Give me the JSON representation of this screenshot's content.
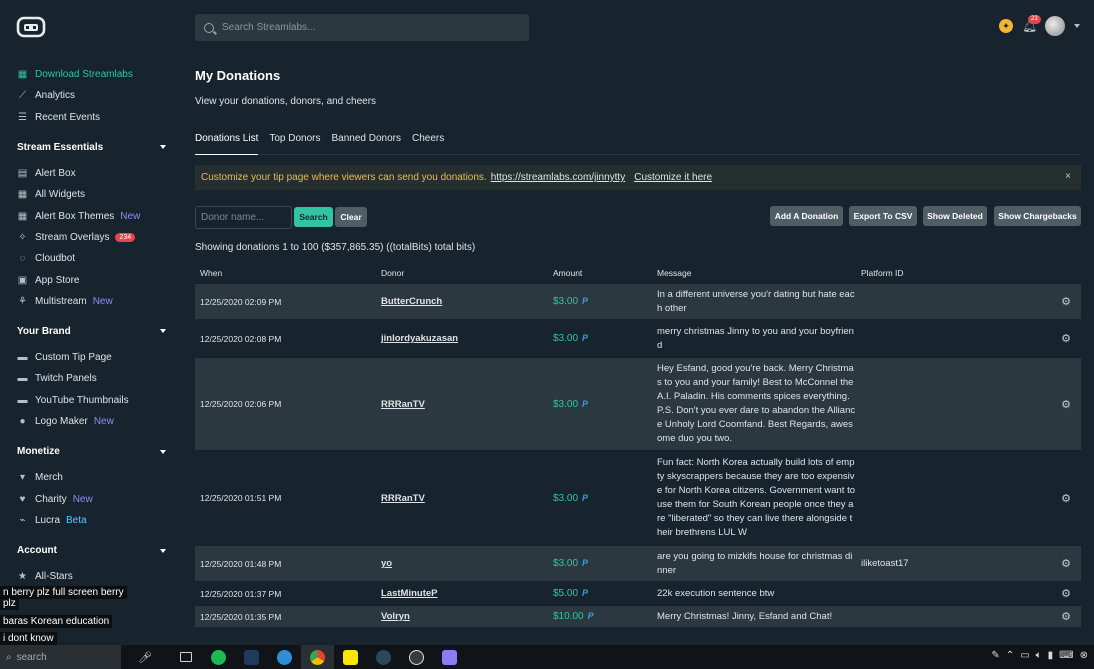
{
  "search": {
    "placeholder": "Search Streamlabs..."
  },
  "header": {
    "notification_count": "23"
  },
  "sidebar": {
    "top_items": [
      {
        "label": "Download Streamlabs",
        "icon": "windows-icon"
      },
      {
        "label": "Analytics",
        "icon": "analytics-icon"
      },
      {
        "label": "Recent Events",
        "icon": "list-icon"
      }
    ],
    "sections": [
      {
        "title": "Stream Essentials",
        "items": [
          {
            "label": "Alert Box",
            "tag": ""
          },
          {
            "label": "All Widgets",
            "tag": ""
          },
          {
            "label": "Alert Box Themes",
            "tag": "New"
          },
          {
            "label": "Stream Overlays",
            "tag": "",
            "badge": "234"
          },
          {
            "label": "Cloudbot",
            "tag": ""
          },
          {
            "label": "App Store",
            "tag": ""
          },
          {
            "label": "Multistream",
            "tag": "New"
          }
        ]
      },
      {
        "title": "Your Brand",
        "items": [
          {
            "label": "Custom Tip Page",
            "tag": ""
          },
          {
            "label": "Twitch Panels",
            "tag": ""
          },
          {
            "label": "YouTube Thumbnails",
            "tag": ""
          },
          {
            "label": "Logo Maker",
            "tag": "New"
          }
        ]
      },
      {
        "title": "Monetize",
        "items": [
          {
            "label": "Merch",
            "tag": ""
          },
          {
            "label": "Charity",
            "tag": "New"
          },
          {
            "label": "Lucra",
            "tag": "Beta"
          }
        ]
      },
      {
        "title": "Account",
        "items": [
          {
            "label": "All-Stars",
            "tag": ""
          }
        ]
      }
    ]
  },
  "overlay_chat": [
    "n berry plz full screen berry",
    "plz",
    "baras Korean education",
    "i dont know"
  ],
  "main": {
    "title": "My Donations",
    "subtitle": "View your donations, donors, and cheers",
    "tabs": [
      "Donations List",
      "Top Donors",
      "Banned Donors",
      "Cheers"
    ],
    "banner": {
      "text": "Customize your tip page where viewers can send you donations.",
      "link": "https://streamlabs.com/jinnytty",
      "customize": "Customize it here",
      "close": "×"
    },
    "filters": {
      "donor_placeholder": "Donor name...",
      "search": "Search",
      "clear": "Clear",
      "add": "Add A Donation",
      "export": "Export To CSV",
      "show_deleted": "Show Deleted",
      "show_chargebacks": "Show Chargebacks"
    },
    "showing": "Showing donations 1 to 100 ($357,865.35) ((totalBits) total bits)",
    "columns": [
      "When",
      "Donor",
      "Amount",
      "Message",
      "Platform ID"
    ],
    "rows": [
      {
        "when": "12/25/2020 02:09 PM",
        "donor": "ButterCrunch",
        "amount": "$3.00",
        "message": "In a different universe you'r dating but hate each other",
        "pid": ""
      },
      {
        "when": "12/25/2020 02:08 PM",
        "donor": "jinlordyakuzasan",
        "amount": "$3.00",
        "message": "merry christmas Jinny to you and your boyfriend",
        "pid": ""
      },
      {
        "when": "12/25/2020 02:06 PM",
        "donor": "RRRanTV",
        "amount": "$3.00",
        "message": "Hey Esfand, good you're back. Merry Christmas to you and your family! Best to McConnel the A.I. Paladin. His comments spices everything. P.S. Don't you ever dare to abandon the Alliance Unholy Lord Coomfand. Best Regards, awesome duo you two.",
        "pid": ""
      },
      {
        "when": "12/25/2020 01:51 PM",
        "donor": "RRRanTV",
        "amount": "$3.00",
        "message": "Fun fact: North Korea actually build lots of empty skyscrappers because they are too expensive for North Korea citizens. Government want to use them for South Korean people once they are \"liberated\" so they can live there alongside their brethrens LUL W",
        "pid": ""
      },
      {
        "when": "12/25/2020 01:48 PM",
        "donor": "yo",
        "amount": "$3.00",
        "message": "are you going to mizkifs house for christmas dinner",
        "pid": "iliketoast17"
      },
      {
        "when": "12/25/2020 01:37 PM",
        "donor": "LastMinuteP",
        "amount": "$5.00",
        "message": "22k execution sentence btw",
        "pid": ""
      },
      {
        "when": "12/25/2020 01:35 PM",
        "donor": "Volryn",
        "amount": "$10.00",
        "message": "Merry Christmas! Jinny, Esfand and Chat!",
        "pid": ""
      }
    ]
  },
  "taskbar": {
    "search_placeholder": "search"
  },
  "colors": {
    "accent": "#31c3a2",
    "background": "#17242d",
    "row_alt": "#2b3840",
    "warning_text": "#f0b84a"
  }
}
